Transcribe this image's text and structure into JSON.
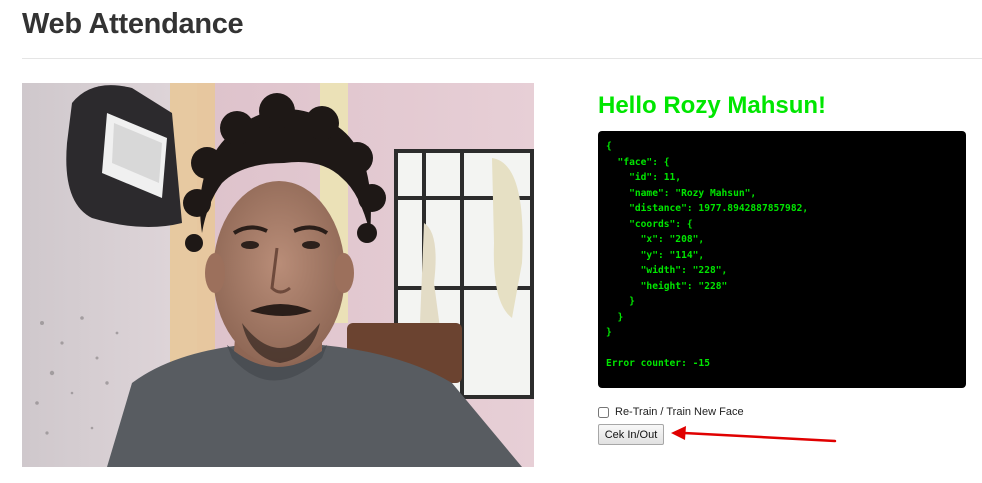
{
  "header": {
    "title": "Web Attendance"
  },
  "result": {
    "greeting": "Hello Rozy Mahsun!",
    "color": "#00e600",
    "json_lines": [
      "{",
      "  \"face\": {",
      "    \"id\": 11,",
      "    \"name\": \"Rozy Mahsun\",",
      "    \"distance\": 1977.8942887857982,",
      "    \"coords\": {",
      "      \"x\": \"208\",",
      "      \"y\": \"114\",",
      "      \"width\": \"228\",",
      "      \"height\": \"228\"",
      "    }",
      "  }",
      "}",
      "",
      "Error counter: -15"
    ]
  },
  "controls": {
    "retrain_label": "Re-Train / Train New Face",
    "retrain_checked": false,
    "checkin_label": "Cek In/Out"
  },
  "annotation": {
    "arrow_color": "#e00000",
    "arrow_icon": "red-arrow-icon"
  }
}
